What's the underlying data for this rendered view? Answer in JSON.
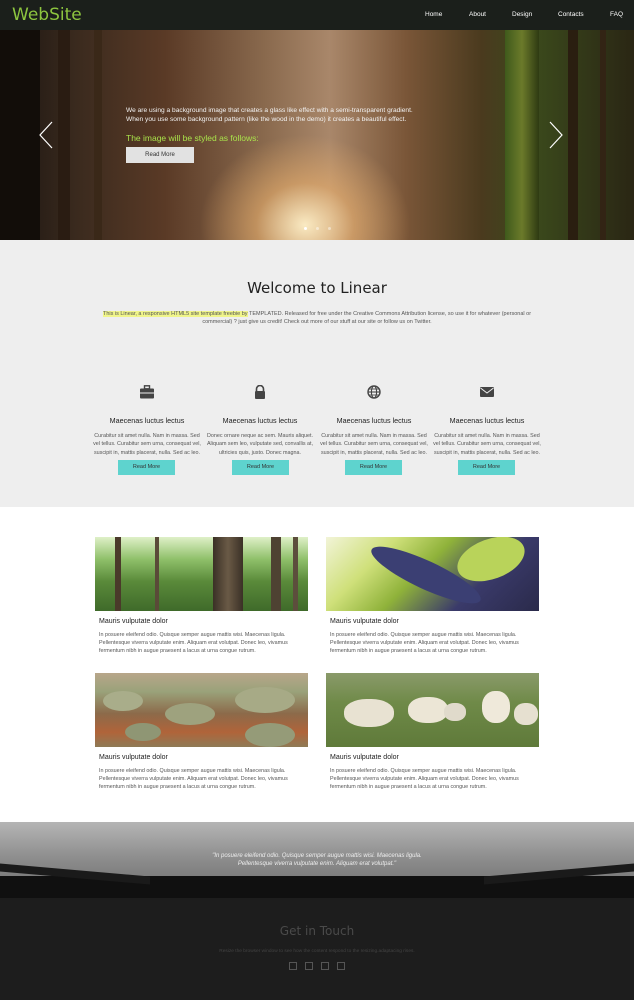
{
  "header": {
    "logo": "WebSite",
    "nav": [
      "Home",
      "About",
      "Design",
      "Contacts",
      "FAQ"
    ]
  },
  "hero": {
    "line1": "We are using a background image that creates a glass like effect with a semi-transparent gradient.",
    "line2": "When you use some background pattern (like the wood in the demo) it creates a beautiful effect.",
    "highlight": "The image will be styled as follows:",
    "button": "Read More",
    "slides": 3,
    "active_slide": 1
  },
  "welcome": {
    "title": "Welcome to Linear",
    "intro_highlight": "This is Linear, a responsive HTML5 site template freebie by",
    "intro_rest": " TEMPLATED. Released for free under the Creative Commons Attribution license, so use it for whatever (personal or commercial) ? just give us credit! Check out more of our stuff at our site or follow us on Twitter."
  },
  "features": [
    {
      "icon": "briefcase-icon",
      "title": "Maecenas luctus lectus",
      "text": "Curabitur sit amet nulla. Nam in massa. Sed vel tellus. Curabitur sem urna, consequat vel, suscipit in, mattis placerat, nulla. Sed ac leo.",
      "button": "Read More"
    },
    {
      "icon": "lock-icon",
      "title": "Maecenas luctus lectus",
      "text": "Donec ornare neque ac sem. Mauris aliquet. Aliquam sem leo, vulputate sed, convallis at, ultricies quis, justo. Donec magna.",
      "button": "Read More"
    },
    {
      "icon": "globe-icon",
      "title": "Maecenas luctus lectus",
      "text": "Curabitur sit amet nulla. Nam in massa. Sed vel tellus. Curabitur sem urna, consequat vel, suscipit in, mattis placerat, nulla. Sed ac leo.",
      "button": "Read More"
    },
    {
      "icon": "envelope-icon",
      "title": "Maecenas luctus lectus",
      "text": "Curabitur sit amet nulla. Nam in massa. Sed vel tellus. Curabitur sem urna, consequat vel, suscipit in, mattis placerat, nulla. Sed ac leo.",
      "button": "Read More"
    }
  ],
  "gallery": [
    {
      "image": "forest",
      "title": "Mauris vulputate dolor",
      "text": "In posuere eleifend odio. Quisque semper augue mattis wisi. Maecenas ligula. Pellentesque viverra vulputate enim. Aliquam erat volutpat. Donec leo, vivamus fermentum nibh in augue praesent a lacus at urna congue rutrum."
    },
    {
      "image": "leaf",
      "title": "Mauris vulputate dolor",
      "text": "In posuere eleifend odio. Quisque semper augue mattis wisi. Maecenas ligula. Pellentesque viverra vulputate enim. Aliquam erat volutpat. Donec leo, vivamus fermentum nibh in augue praesent a lacus at urna congue rutrum."
    },
    {
      "image": "shrubland",
      "title": "Mauris vulputate dolor",
      "text": "In posuere eleifend odio. Quisque semper augue mattis wisi. Maecenas ligula. Pellentesque viverra vulputate enim. Aliquam erat volutpat. Donec leo, vivamus fermentum nibh in augue praesent a lacus at urna congue rutrum."
    },
    {
      "image": "sheep",
      "title": "Mauris vulputate dolor",
      "text": "In posuere eleifend odio. Quisque semper augue mattis wisi. Maecenas ligula. Pellentesque viverra vulputate enim. Aliquam erat volutpat. Donec leo, vivamus fermentum nibh in augue praesent a lacus at urna congue rutrum."
    }
  ],
  "quote": {
    "line1": "\"In posuere eleifend odio. Quisque semper augue mattis wisi. Maecenas ligula.",
    "line2": "Pellentesque viverra vulputate enim. Aliquam erat volutpat.\""
  },
  "footer": {
    "title": "Get in Touch",
    "subtitle": "Resize the browser window to see how the content respond to the resizing.adaptacing rises.",
    "social": [
      "twitter-icon",
      "facebook-icon",
      "dribbble-icon",
      "linkedin-icon"
    ]
  },
  "colors": {
    "accent": "#8dc63f",
    "hero_highlight": "#a9e34b",
    "button_teal": "#5ed3ce",
    "header_bg": "#1b1f1b",
    "footer_bg": "#1d1d1d"
  }
}
